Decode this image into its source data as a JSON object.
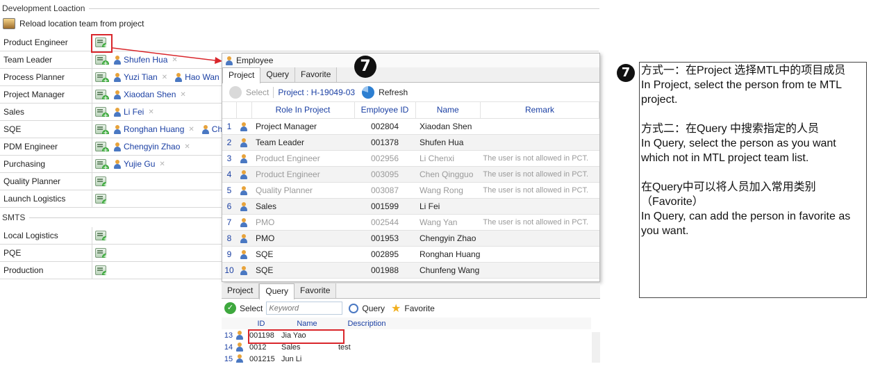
{
  "groups": {
    "dev": "Development Loaction",
    "smts": "SMTS"
  },
  "reload_label": "Reload location team from project",
  "rows": [
    {
      "label": "Product Engineer",
      "people": []
    },
    {
      "label": "Team Leader",
      "people": [
        "Shufen Hua"
      ]
    },
    {
      "label": "Process Planner",
      "people": [
        "Yuzi Tian",
        "Hao Wan"
      ]
    },
    {
      "label": "Project Manager",
      "people": [
        "Xiaodan Shen"
      ]
    },
    {
      "label": "Sales",
      "people": [
        "Li Fei"
      ]
    },
    {
      "label": "SQE",
      "people": [
        "Ronghan Huang",
        "Ch"
      ]
    },
    {
      "label": "PDM Engineer",
      "people": [
        "Chengyin Zhao"
      ]
    },
    {
      "label": "Purchasing",
      "people": [
        "Yujie Gu"
      ]
    },
    {
      "label": "Quality Planner",
      "people": []
    },
    {
      "label": "Launch Logistics",
      "people": []
    }
  ],
  "smts_rows": [
    {
      "label": "Local Logistics"
    },
    {
      "label": "PQE"
    },
    {
      "label": "Production"
    }
  ],
  "popup": {
    "title": "Employee",
    "tabs": [
      "Project",
      "Query",
      "Favorite"
    ],
    "select_label": "Select",
    "project_label": "Project : H-19049-03",
    "refresh_label": "Refresh",
    "columns": [
      "Role In Project",
      "Employee ID",
      "Name",
      "Remark"
    ],
    "rows": [
      {
        "n": "1",
        "role": "Project Manager",
        "id": "002804",
        "name": "Xiaodan Shen",
        "remark": "",
        "dim": false
      },
      {
        "n": "2",
        "role": "Team Leader",
        "id": "001378",
        "name": "Shufen Hua",
        "remark": "",
        "dim": false
      },
      {
        "n": "3",
        "role": "Product Engineer",
        "id": "002956",
        "name": "Li Chenxi",
        "remark": "The user is not allowed in PCT.",
        "dim": true
      },
      {
        "n": "4",
        "role": "Product Engineer",
        "id": "003095",
        "name": "Chen Qingguo",
        "remark": "The user is not allowed in PCT.",
        "dim": true
      },
      {
        "n": "5",
        "role": "Quality Planner",
        "id": "003087",
        "name": "Wang Rong",
        "remark": "The user is not allowed in PCT.",
        "dim": true
      },
      {
        "n": "6",
        "role": "Sales",
        "id": "001599",
        "name": "Li Fei",
        "remark": "",
        "dim": false
      },
      {
        "n": "7",
        "role": "PMO",
        "id": "002544",
        "name": "Wang Yan",
        "remark": "The user is not allowed in PCT.",
        "dim": true
      },
      {
        "n": "8",
        "role": "PMO",
        "id": "001953",
        "name": "Chengyin Zhao",
        "remark": "",
        "dim": false
      },
      {
        "n": "9",
        "role": "SQE",
        "id": "002895",
        "name": "Ronghan Huang",
        "remark": "",
        "dim": false
      },
      {
        "n": "10",
        "role": "SQE",
        "id": "001988",
        "name": "Chunfeng Wang",
        "remark": "",
        "dim": false
      }
    ]
  },
  "query": {
    "tabs": [
      "Project",
      "Query",
      "Favorite"
    ],
    "select_label": "Select",
    "keyword_placeholder": "Keyword",
    "query_label": "Query",
    "favorite_label": "Favorite",
    "columns": [
      "ID",
      "Name",
      "Description"
    ],
    "rows": [
      {
        "n": "13",
        "id": "001198",
        "name": "Jia Yao",
        "desc": ""
      },
      {
        "n": "14",
        "id": "0012",
        "name": "Sales",
        "desc": "test"
      },
      {
        "n": "15",
        "id": "001215",
        "name": "Jun Li",
        "desc": ""
      }
    ]
  },
  "step_number": "7",
  "note": {
    "badge": "7",
    "lines": [
      "方式一：在Project 选择MTL中的项目成员",
      "In Project, select the person from te MTL project.",
      "",
      "方式二：在Query 中搜索指定的人员",
      "In Query, select the person as you want which not in MTL project team list.",
      "",
      "在Query中可以将人员加入常用类别（Favorite）",
      "In Query, can add the person in favorite as you want."
    ]
  },
  "colors": {
    "highlight": "#d9262b",
    "link": "#1a3fa3"
  }
}
